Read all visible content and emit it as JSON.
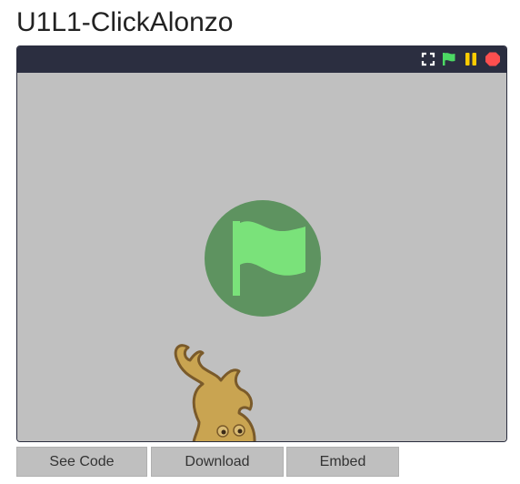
{
  "page": {
    "title": "U1L1-ClickAlonzo"
  },
  "player": {
    "controls": [
      {
        "name": "fullscreen-icon",
        "color": "#ffffff"
      },
      {
        "name": "green-flag-icon",
        "color": "#4cd964"
      },
      {
        "name": "pause-icon",
        "color": "#ffcc00"
      },
      {
        "name": "stop-icon",
        "color": "#ff4f4f"
      }
    ],
    "stage": {
      "background": "#c0c0c0",
      "overlay_icon": "green-flag-icon",
      "sprite": "alonzo-sprite"
    }
  },
  "buttons": {
    "see_code": "See Code",
    "download": "Download",
    "embed": "Embed"
  }
}
